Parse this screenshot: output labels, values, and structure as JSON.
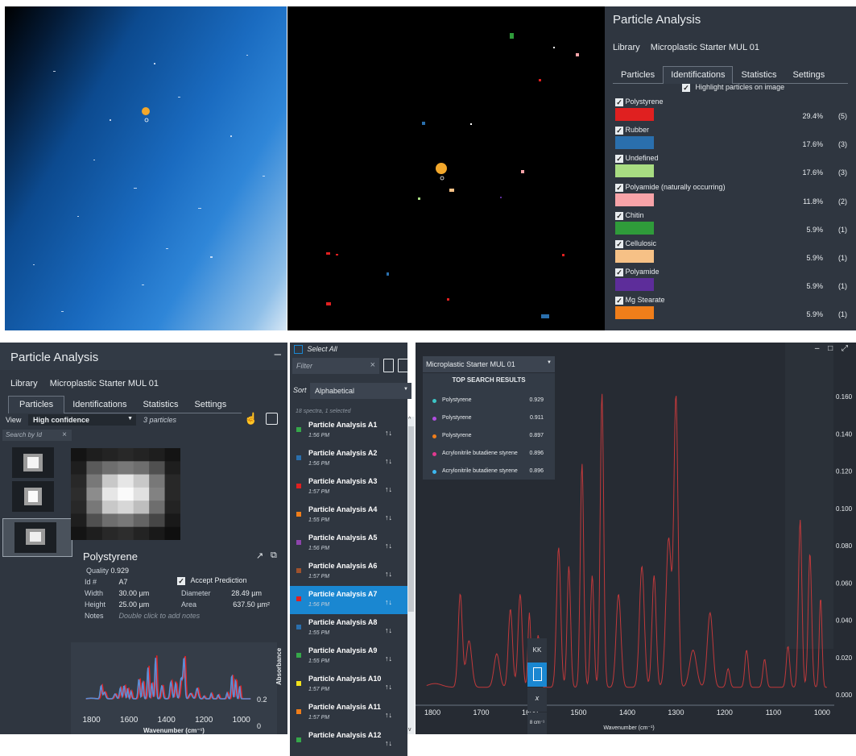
{
  "top_panel": {
    "title": "Particle Analysis",
    "library_label": "Library",
    "library_value": "Microplastic Starter MUL 01",
    "tabs": [
      "Particles",
      "Identifications",
      "Statistics",
      "Settings"
    ],
    "active_tab": "Identifications",
    "highlight_label": "Highlight particles on image",
    "legend": [
      {
        "name": "Polystyrene",
        "color": "#e02020",
        "pct": "29.4%",
        "count": "(5)"
      },
      {
        "name": "Rubber",
        "color": "#2a6fad",
        "pct": "17.6%",
        "count": "(3)"
      },
      {
        "name": "Undefined",
        "color": "#a8dc82",
        "pct": "17.6%",
        "count": "(3)"
      },
      {
        "name": "Polyamide (naturally occurring)",
        "color": "#f7a3a8",
        "pct": "11.8%",
        "count": "(2)"
      },
      {
        "name": "Chitin",
        "color": "#2f9b3a",
        "pct": "5.9%",
        "count": "(1)"
      },
      {
        "name": "Cellulosic",
        "color": "#f6c186",
        "pct": "5.9%",
        "count": "(1)"
      },
      {
        "name": "Polyamide",
        "color": "#5d2d9a",
        "pct": "5.9%",
        "count": "(1)"
      },
      {
        "name": "Mg Stearate",
        "color": "#f07e1a",
        "pct": "5.9%",
        "count": "(1)"
      }
    ]
  },
  "bottom_panel": {
    "title": "Particle Analysis",
    "minimize": "–",
    "library_label": "Library",
    "library_value": "Microplastic Starter MUL 01",
    "tabs": [
      "Particles",
      "Identifications",
      "Statistics",
      "Settings"
    ],
    "active_tab": "Particles",
    "view_label": "View",
    "view_value": "High confidence",
    "particle_count": "3 particles",
    "search_placeholder": "Search by Id",
    "search_clear": "×",
    "particle": {
      "name": "Polystyrene",
      "quality_label": "Quality",
      "quality": "0.929",
      "id_label": "Id #",
      "id": "A7",
      "accept_label": "Accept Prediction",
      "width_label": "Width",
      "width": "30.00 µm",
      "diameter_label": "Diameter",
      "diameter": "28.49 µm",
      "height_label": "Height",
      "height": "25.00 µm",
      "area_label": "Area",
      "area": "637.50 µm²",
      "notes_label": "Notes",
      "notes_placeholder": "Double click to add notes"
    },
    "mini_chart": {
      "ylabel": "Absorbance",
      "xlabel": "Wavenumber (cm⁻¹)",
      "xticks": [
        "1800",
        "1600",
        "1400",
        "1200",
        "1000"
      ],
      "yticks": [
        "0.2",
        "0"
      ]
    }
  },
  "list_panel": {
    "select_all": "Select All",
    "filter_placeholder": "Filter",
    "filter_clear": "×",
    "sort_label": "Sort",
    "sort_value": "Alphabetical",
    "summary": "18 spectra, 1 selected",
    "items": [
      {
        "name": "Particle Analysis A1",
        "time": "1:56 PM",
        "color": "#36a84a"
      },
      {
        "name": "Particle Analysis A2",
        "time": "1:56 PM",
        "color": "#2a6fad"
      },
      {
        "name": "Particle Analysis A3",
        "time": "1:57 PM",
        "color": "#e02020"
      },
      {
        "name": "Particle Analysis A4",
        "time": "1:55 PM",
        "color": "#f07e1a"
      },
      {
        "name": "Particle Analysis A5",
        "time": "1:56 PM",
        "color": "#8e44ad"
      },
      {
        "name": "Particle Analysis A6",
        "time": "1:57 PM",
        "color": "#a0522d"
      },
      {
        "name": "Particle Analysis A7",
        "time": "1:56 PM",
        "color": "#e02020",
        "selected": true
      },
      {
        "name": "Particle Analysis A8",
        "time": "1:55 PM",
        "color": "#2a6fad"
      },
      {
        "name": "Particle Analysis A9",
        "time": "1:55 PM",
        "color": "#36a84a"
      },
      {
        "name": "Particle Analysis A10",
        "time": "1:57 PM",
        "color": "#f2e21c"
      },
      {
        "name": "Particle Analysis A11",
        "time": "1:57 PM",
        "color": "#f07e1a"
      },
      {
        "name": "Particle Analysis A12",
        "time": "",
        "color": "#36a84a"
      }
    ]
  },
  "spectrum_panel": {
    "library_dropdown": "Microplastic Starter MUL 01",
    "results_title": "TOP SEARCH RESULTS",
    "results": [
      {
        "name": "Polystyrene",
        "score": "0.929",
        "color": "#3cc6c6"
      },
      {
        "name": "Polystyrene",
        "score": "0.911",
        "color": "#b04ee0"
      },
      {
        "name": "Polystyrene",
        "score": "0.897",
        "color": "#f07e1a"
      },
      {
        "name": "Acrylonitrile butadiene styrene",
        "score": "0.896",
        "color": "#e0398f"
      },
      {
        "name": "Acrylonitrile butadiene styrene",
        "score": "0.896",
        "color": "#3cb7f0"
      }
    ],
    "window_controls": "– □ ⤢",
    "tool_kk": "KK",
    "tool_x": "x",
    "tool_res": "8 cm⁻¹",
    "xlabel": "Wavenumber (cm⁻¹)",
    "xticks": [
      "1800",
      "1700",
      "1600",
      "1500",
      "1400",
      "1300",
      "1200",
      "1100",
      "1000"
    ],
    "yticks": [
      "0.160",
      "0.140",
      "0.120",
      "0.100",
      "0.080",
      "0.060",
      "0.040",
      "0.020",
      "0.000"
    ],
    "line_color": "#c0393b"
  }
}
